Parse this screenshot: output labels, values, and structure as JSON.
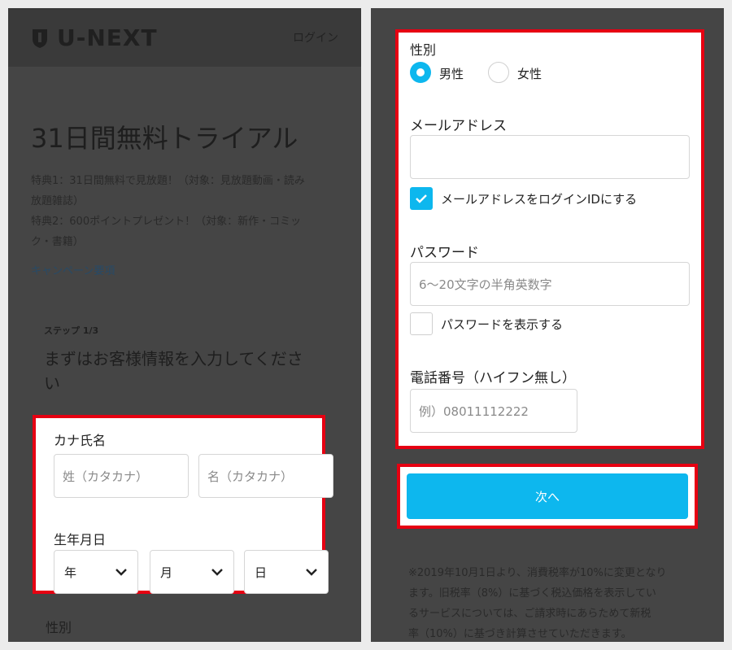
{
  "left": {
    "logo_text": "U-NEXT",
    "login": "ログイン",
    "title": "31日間無料トライアル",
    "desc_lines": [
      "特典1：31日間無料で見放題！（対象：見放題動画・読み",
      "放題雑誌）",
      "特典2：600ポイントプレゼント！（対象：新作・コミッ",
      "ク・書籍）"
    ],
    "campaign_link": "キャンペーン要項",
    "step": "ステップ 1/3",
    "heading_lines": [
      "まずはお客様情報を入力してくださ",
      "い"
    ],
    "kana_label": "カナ氏名",
    "kana_last_placeholder": "姓（カタカナ）",
    "kana_first_placeholder": "名（カタカナ）",
    "birth_label": "生年月日",
    "year": "年",
    "month": "月",
    "day": "日",
    "gender_label": "性別"
  },
  "right": {
    "gender_label": "性別",
    "gender_male": "男性",
    "gender_female": "女性",
    "email_label": "メールアドレス",
    "email_value": "",
    "email_as_id": "メールアドレスをログインIDにする",
    "password_label": "パスワード",
    "password_placeholder": "6〜20文字の半角英数字",
    "show_password": "パスワードを表示する",
    "phone_label": "電話番号（ハイフン無し）",
    "phone_placeholder": "例）08011112222",
    "next_button": "次へ",
    "note_lines": [
      "※2019年10月1日より、消費税率が10%に変更となり",
      "ます。旧税率（8%）に基づく税込価格を表示してい",
      "るサービスについては、ご請求時にあらためて新税",
      "率（10%）に基づき計算させていただきます。"
    ]
  },
  "colors": {
    "accent": "#0db7ee",
    "highlight": "#e60012",
    "overlay": "#454545"
  }
}
